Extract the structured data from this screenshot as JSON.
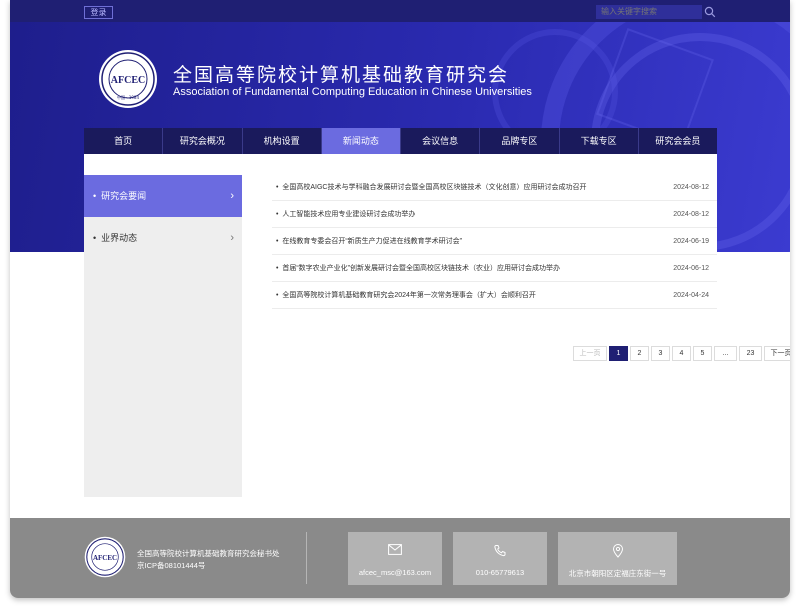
{
  "topbar": {
    "login_label": "登录",
    "search_placeholder": "输入关键字搜索"
  },
  "header": {
    "title_cn": "全国高等院校计算机基础教育研究会",
    "title_en": "Association of Fundamental Computing Education in Chinese Universities",
    "logo_text": "AFCEC",
    "logo_ring_text": "全国高等院校计算机基础教育研究会",
    "logo_year": "中国 · 1984"
  },
  "nav": [
    {
      "label": "首页",
      "active": false
    },
    {
      "label": "研究会概况",
      "active": false
    },
    {
      "label": "机构设置",
      "active": false
    },
    {
      "label": "新闻动态",
      "active": true
    },
    {
      "label": "会议信息",
      "active": false
    },
    {
      "label": "品牌专区",
      "active": false
    },
    {
      "label": "下载专区",
      "active": false
    },
    {
      "label": "研究会会员",
      "active": false
    }
  ],
  "sidebar": [
    {
      "label": "研究会要闻",
      "active": true
    },
    {
      "label": "业界动态",
      "active": false
    }
  ],
  "news": [
    {
      "title": "全国高校AIGC技术与学科融合发展研讨会暨全国高校区块链技术（文化创意）应用研讨会成功召开",
      "date": "2024-08-12"
    },
    {
      "title": "人工智能技术应用专业建设研讨会成功举办",
      "date": "2024-08-12"
    },
    {
      "title": "在线教育专委会召开“新质生产力促进在线教育学术研讨会”",
      "date": "2024-06-19"
    },
    {
      "title": "首届“数字农业产业化”创新发展研讨会暨全国高校区块链技术（农业）应用研讨会成功举办",
      "date": "2024-06-12"
    },
    {
      "title": "全国高等院校计算机基础教育研究会2024年第一次常务理事会（扩大）会顺利召开",
      "date": "2024-04-24"
    }
  ],
  "pager": {
    "prev": "上一页",
    "pages": [
      "1",
      "2",
      "3",
      "4",
      "5",
      "...",
      "23"
    ],
    "current": "1",
    "next": "下一页"
  },
  "footer": {
    "org": "全国高等院校计算机基础教育研究会秘书处",
    "icp": "京ICP备08101444号",
    "email": "afcec_msc@163.com",
    "phone": "010-65779613",
    "address": "北京市朝阳区定福庄东街一号"
  },
  "colors": {
    "primary": "#1f1f73",
    "accent": "#6b6be0",
    "footer": "#8a8a8a"
  }
}
